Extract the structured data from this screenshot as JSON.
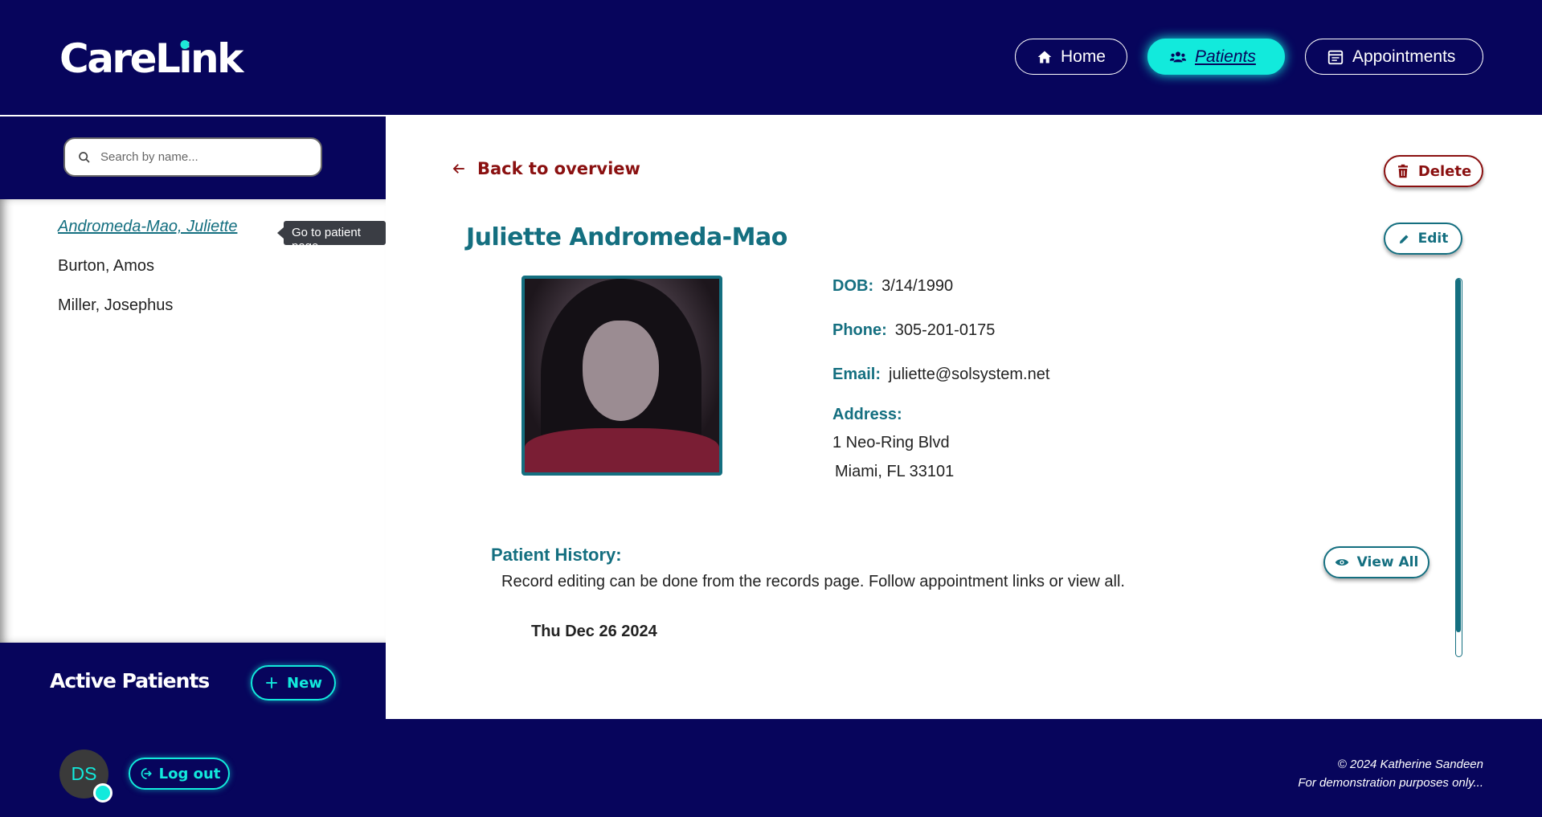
{
  "header": {
    "logo_prefix": "CareL",
    "logo_i": "i",
    "logo_suffix": "nk",
    "nav": {
      "home": "Home",
      "patients": "Patients",
      "appointments": "Appointments"
    }
  },
  "sidebar": {
    "search_placeholder": "Search by name...",
    "patients": [
      {
        "name": "Andromeda-Mao, Juliette",
        "active": true
      },
      {
        "name": "Burton, Amos",
        "active": false
      },
      {
        "name": "Miller, Josephus",
        "active": false
      }
    ],
    "tooltip": "Go to patient page",
    "section_title": "Active Patients",
    "new_label": "New"
  },
  "main": {
    "back_label": "Back to overview",
    "delete_label": "Delete",
    "edit_label": "Edit",
    "patient_name": "Juliette Andromeda-Mao",
    "dob_label": "DOB:",
    "dob": "3/14/1990",
    "phone_label": "Phone:",
    "phone": "305-201-0175",
    "email_label": "Email:",
    "email": "juliette@solsystem.net",
    "address_label": "Address:",
    "address_line1": "1 Neo-Ring Blvd",
    "address_line2": "Miami, FL 33101",
    "history_title": "Patient History:",
    "history_note": "Record editing can be done from the records page. Follow appointment links or view all.",
    "view_all_label": "View All",
    "history_dates": [
      "Thu Dec 26 2024"
    ]
  },
  "footer": {
    "avatar_initials": "DS",
    "logout_label": "Log out",
    "copyright": "© 2024 Katherine Sandeen",
    "disclaimer": "For demonstration purposes only..."
  },
  "colors": {
    "navy": "#07055c",
    "teal": "#146f80",
    "cyan": "#12eadc",
    "danger": "#8a1010"
  }
}
